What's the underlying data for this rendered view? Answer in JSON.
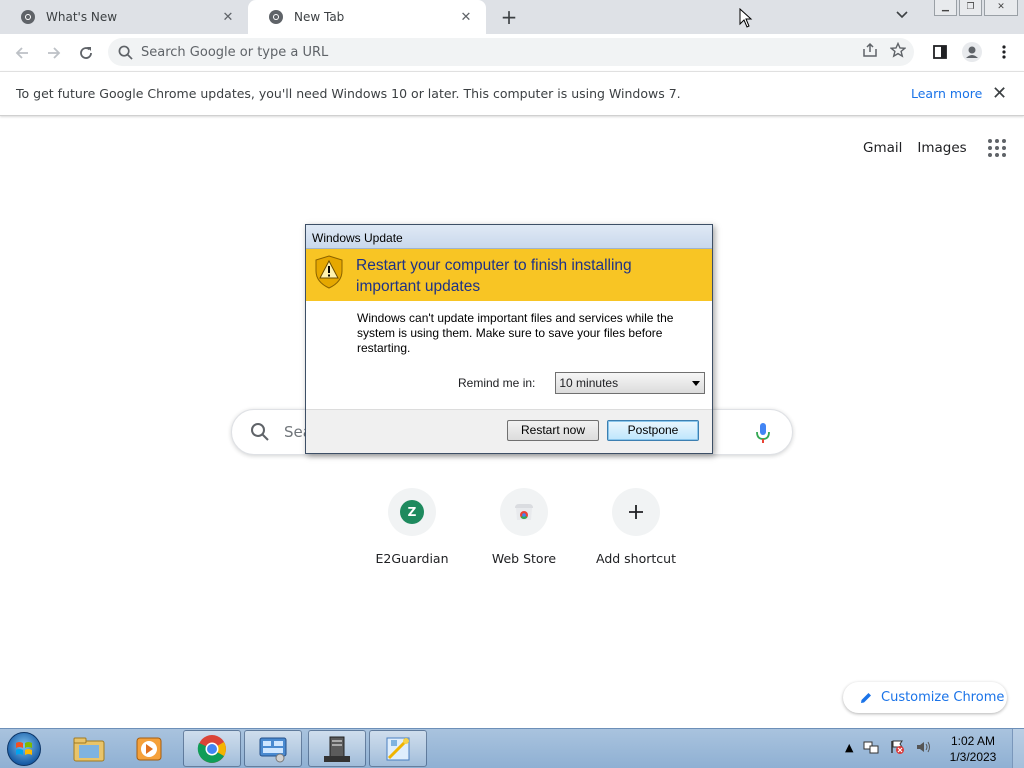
{
  "browser": {
    "tabs": [
      {
        "title": "What's New",
        "active": false
      },
      {
        "title": "New Tab",
        "active": true
      }
    ],
    "omnibox_placeholder": "Search Google or type a URL"
  },
  "infobar": {
    "message": "To get future Google Chrome updates, you'll need Windows 10 or later. This computer is using Windows 7.",
    "link": "Learn more"
  },
  "ntp": {
    "links": [
      "Gmail",
      "Images"
    ],
    "search_placeholder": "Sea",
    "shortcuts": [
      {
        "label": "E2Guardian",
        "badge": "Z"
      },
      {
        "label": "Web Store"
      },
      {
        "label": "Add shortcut"
      }
    ],
    "customize_label": "Customize Chrome"
  },
  "dialog": {
    "title": "Windows Update",
    "heading": "Restart your computer to finish installing important updates",
    "description": "Windows can't update important files and services while the system is using them. Make sure to save your files before restarting.",
    "remind_label": "Remind me in:",
    "remind_value": "10 minutes",
    "restart_button": "Restart now",
    "postpone_button": "Postpone"
  },
  "taskbar": {
    "time": "1:02 AM",
    "date": "1/3/2023"
  },
  "colors": {
    "chrome_blue": "#1a73e8",
    "banner_yellow": "#f8c524",
    "taskbar": "#9fbadb"
  }
}
